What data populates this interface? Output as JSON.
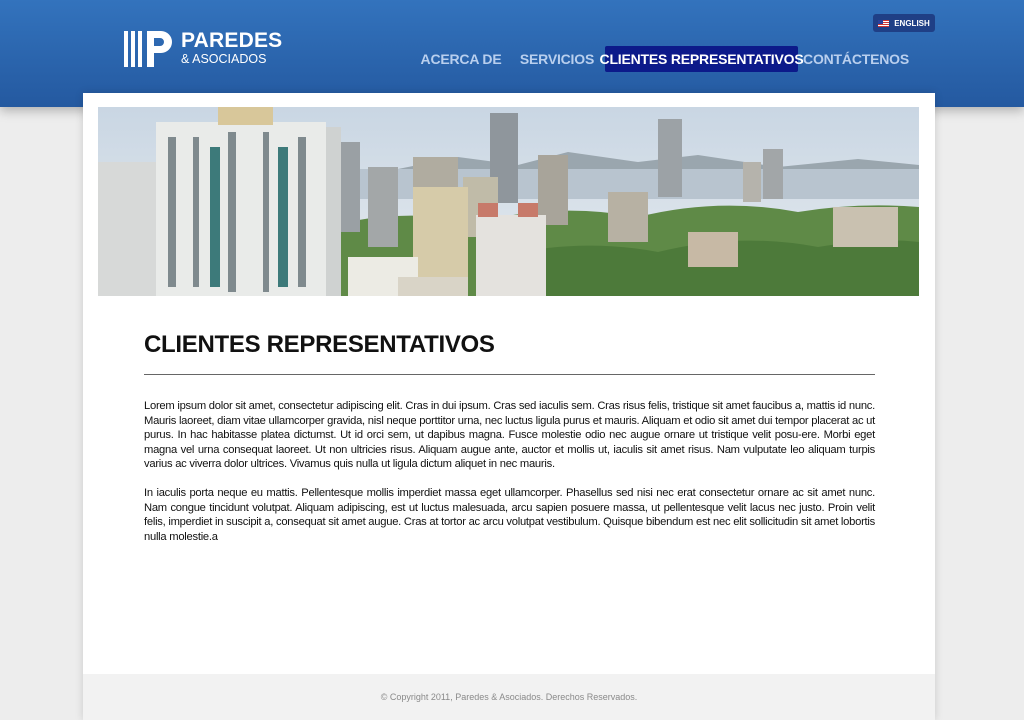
{
  "header": {
    "logo_name": "PAREDES",
    "logo_sub": "& ASOCIADOS",
    "language_label": "ENGLISH",
    "nav": [
      {
        "label": "ACERCA DE",
        "active": false
      },
      {
        "label": "SERVICIOS",
        "active": false
      },
      {
        "label": "CLIENTES REPRESENTATIVOS",
        "active": true
      },
      {
        "label": "CONTÁCTENOS",
        "active": false
      }
    ]
  },
  "main": {
    "title": "CLIENTES REPRESENTATIVOS",
    "paragraphs": [
      "Lorem ipsum dolor sit amet, consectetur adipiscing elit. Cras in dui ipsum. Cras sed iaculis sem. Cras risus felis, tristique sit amet faucibus a, mattis id nunc. Mauris laoreet, diam vitae ullamcorper gravida, nisl neque porttitor urna, nec luctus ligula purus et mauris. Aliquam et odio sit amet dui tempor placerat ac ut purus. In hac habitasse platea dictumst. Ut id orci sem, ut dapibus magna. Fusce molestie odio nec augue ornare ut tristique velit posu-ere. Morbi eget magna vel urna consequat laoreet. Ut non ultricies risus. Aliquam augue ante, auctor et mollis ut, iaculis sit amet risus. Nam vulputate leo aliquam turpis varius ac viverra dolor ultrices. Vivamus quis nulla ut ligula dictum aliquet in nec mauris.",
      "In iaculis porta neque eu mattis. Pellentesque mollis imperdiet massa eget ullamcorper. Phasellus sed nisi nec erat consectetur ornare ac sit amet nunc. Nam congue tincidunt volutpat. Aliquam adipiscing, est ut luctus malesuada, arcu sapien posuere massa, ut pellentesque velit lacus nec justo. Proin velit felis, imperdiet in suscipit a, consequat sit amet augue. Cras at tortor ac arcu volutpat vestibulum. Quisque bibendum est nec elit sollicitudin sit amet lobortis nulla molestie.a"
    ]
  },
  "footer": {
    "copyright": "© Copyright 2011, Paredes & Asociados. Derechos Reservados."
  },
  "colors": {
    "header_blue": "#2b68b2",
    "nav_active": "#0c1a8a",
    "nav_text": "#b9cfee"
  },
  "icons": {
    "logo": "logo-mark-icon",
    "flag": "us-flag-icon"
  }
}
